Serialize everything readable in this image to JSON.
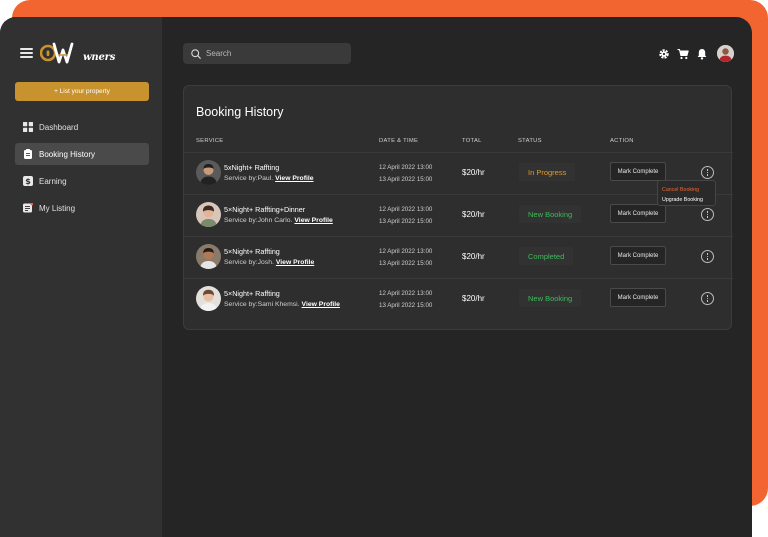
{
  "brand": {
    "logo_text": "wners",
    "accent": "#C8922E",
    "frame": "#F26430"
  },
  "sidebar": {
    "list_property": "+ List your property",
    "items": [
      {
        "label": "Dashboard",
        "icon": "grid-icon",
        "active": false
      },
      {
        "label": "Booking History",
        "icon": "clipboard-icon",
        "active": true
      },
      {
        "label": "Earning",
        "icon": "dollar-icon",
        "active": false
      },
      {
        "label": "My Listing",
        "icon": "list-icon",
        "active": false
      }
    ]
  },
  "topbar": {
    "search_placeholder": "Search"
  },
  "page": {
    "title": "Booking History",
    "columns": {
      "service": "SERVICE",
      "date": "DATE & TIME",
      "total": "TOTAL",
      "status": "STATUS",
      "action": "ACTION"
    }
  },
  "rows": [
    {
      "title": "5xNight+ Raffting",
      "by": "Service by:Paul.",
      "link": "View Profile",
      "date1": "12 April 2022 13:00",
      "date2": "13 April 2022 15:00",
      "total": "$20/hr",
      "status": "In Progress",
      "status_color": "#E29A2E",
      "action": "Mark Complete"
    },
    {
      "title": "5×Night+ Raffting+Dinner",
      "by": "Service by:John Carlo.",
      "link": "View Profile",
      "date1": "12 April 2022 13:00",
      "date2": "13 April 2022 15:00",
      "total": "$20/hr",
      "status": "New Booking",
      "status_color": "#3EBB5A",
      "action": "Mark Complete"
    },
    {
      "title": "5×Night+ Raffting",
      "by": "Service by:Josh.",
      "link": "View Profile",
      "date1": "12 April 2022 13:00",
      "date2": "13 April 2022 15:00",
      "total": "$20/hr",
      "status": "Completed",
      "status_color": "#3EBB5A",
      "action": "Mark Complete"
    },
    {
      "title": "5×Night+ Raffting",
      "by": "Service by:Sami Khemsi.",
      "link": "View Profile",
      "date1": "12 April 2022 13:00",
      "date2": "13 April 2022 15:00",
      "total": "$20/hr",
      "status": "New Booking",
      "status_color": "#3EBB5A",
      "action": "Mark Complete"
    }
  ],
  "dropdown": {
    "cancel": "Cancel Booking",
    "upgrade": "Upgrade Booking"
  }
}
